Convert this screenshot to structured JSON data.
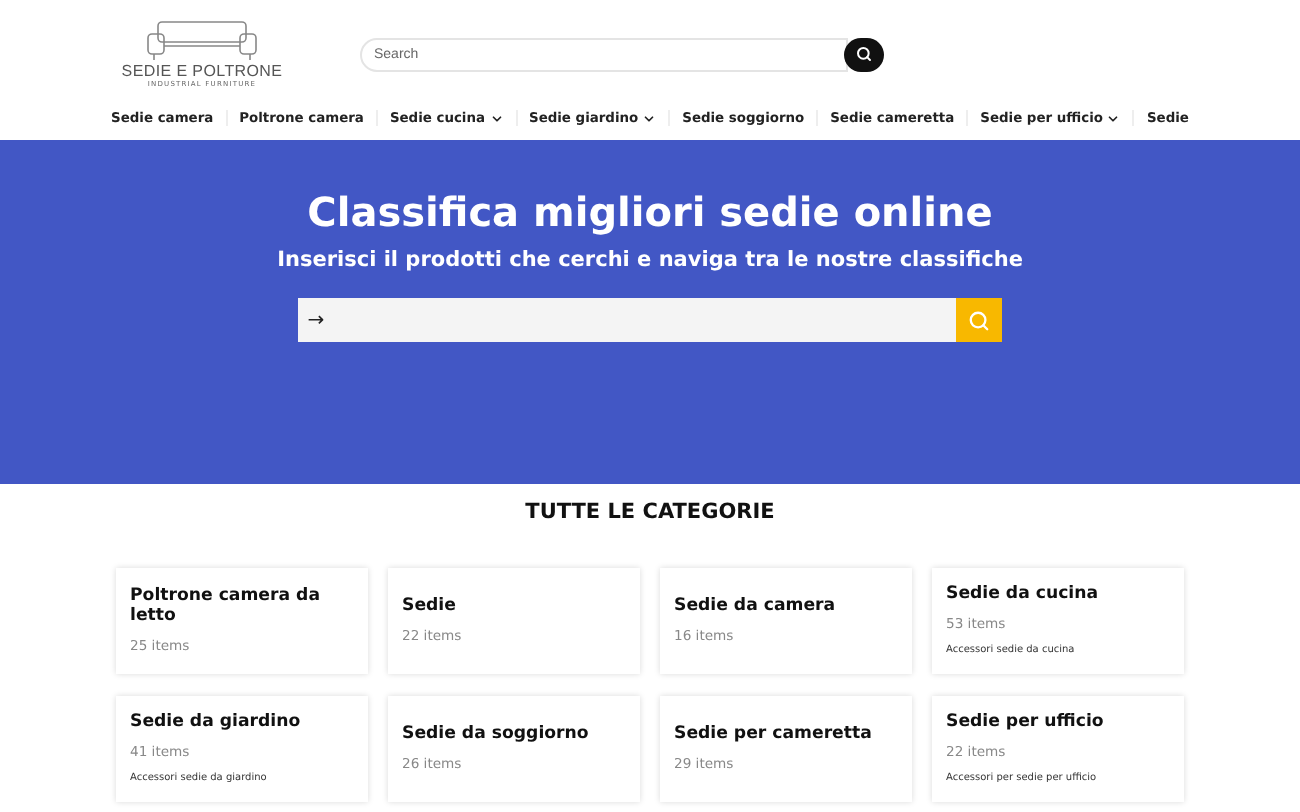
{
  "logo": {
    "title": "SEDIE E POLTRONE",
    "tagline": "INDUSTRIAL FURNITURE"
  },
  "header_search": {
    "placeholder": "Search"
  },
  "nav": [
    {
      "label": "Sedie camera",
      "has_submenu": false
    },
    {
      "label": "Poltrone camera",
      "has_submenu": false
    },
    {
      "label": "Sedie cucina",
      "has_submenu": true
    },
    {
      "label": "Sedie giardino",
      "has_submenu": true
    },
    {
      "label": "Sedie soggiorno",
      "has_submenu": false
    },
    {
      "label": "Sedie cameretta",
      "has_submenu": false
    },
    {
      "label": "Sedie per ufficio",
      "has_submenu": true
    },
    {
      "label": "Sedie",
      "has_submenu": false
    }
  ],
  "hero": {
    "title": "Classifica migliori sedie online",
    "subtitle": "Inserisci il prodotti che cerchi e naviga tra le nostre classifiche",
    "search_arrow": "→"
  },
  "section_title": "TUTTE LE CATEGORIE",
  "categories": [
    {
      "name": "Poltrone camera da letto",
      "count": "25 items"
    },
    {
      "name": "Sedie",
      "count": "22 items"
    },
    {
      "name": "Sedie da camera",
      "count": "16 items"
    },
    {
      "name": "Sedie da cucina",
      "count": "53 items",
      "sub": "Accessori sedie da cucina"
    },
    {
      "name": "Sedie da giardino",
      "count": "41 items",
      "sub": "Accessori sedie da giardino"
    },
    {
      "name": "Sedie da soggiorno",
      "count": "26 items"
    },
    {
      "name": "Sedie per cameretta",
      "count": "29 items"
    },
    {
      "name": "Sedie per ufficio",
      "count": "22 items",
      "sub": "Accessori per sedie per ufficio"
    }
  ]
}
